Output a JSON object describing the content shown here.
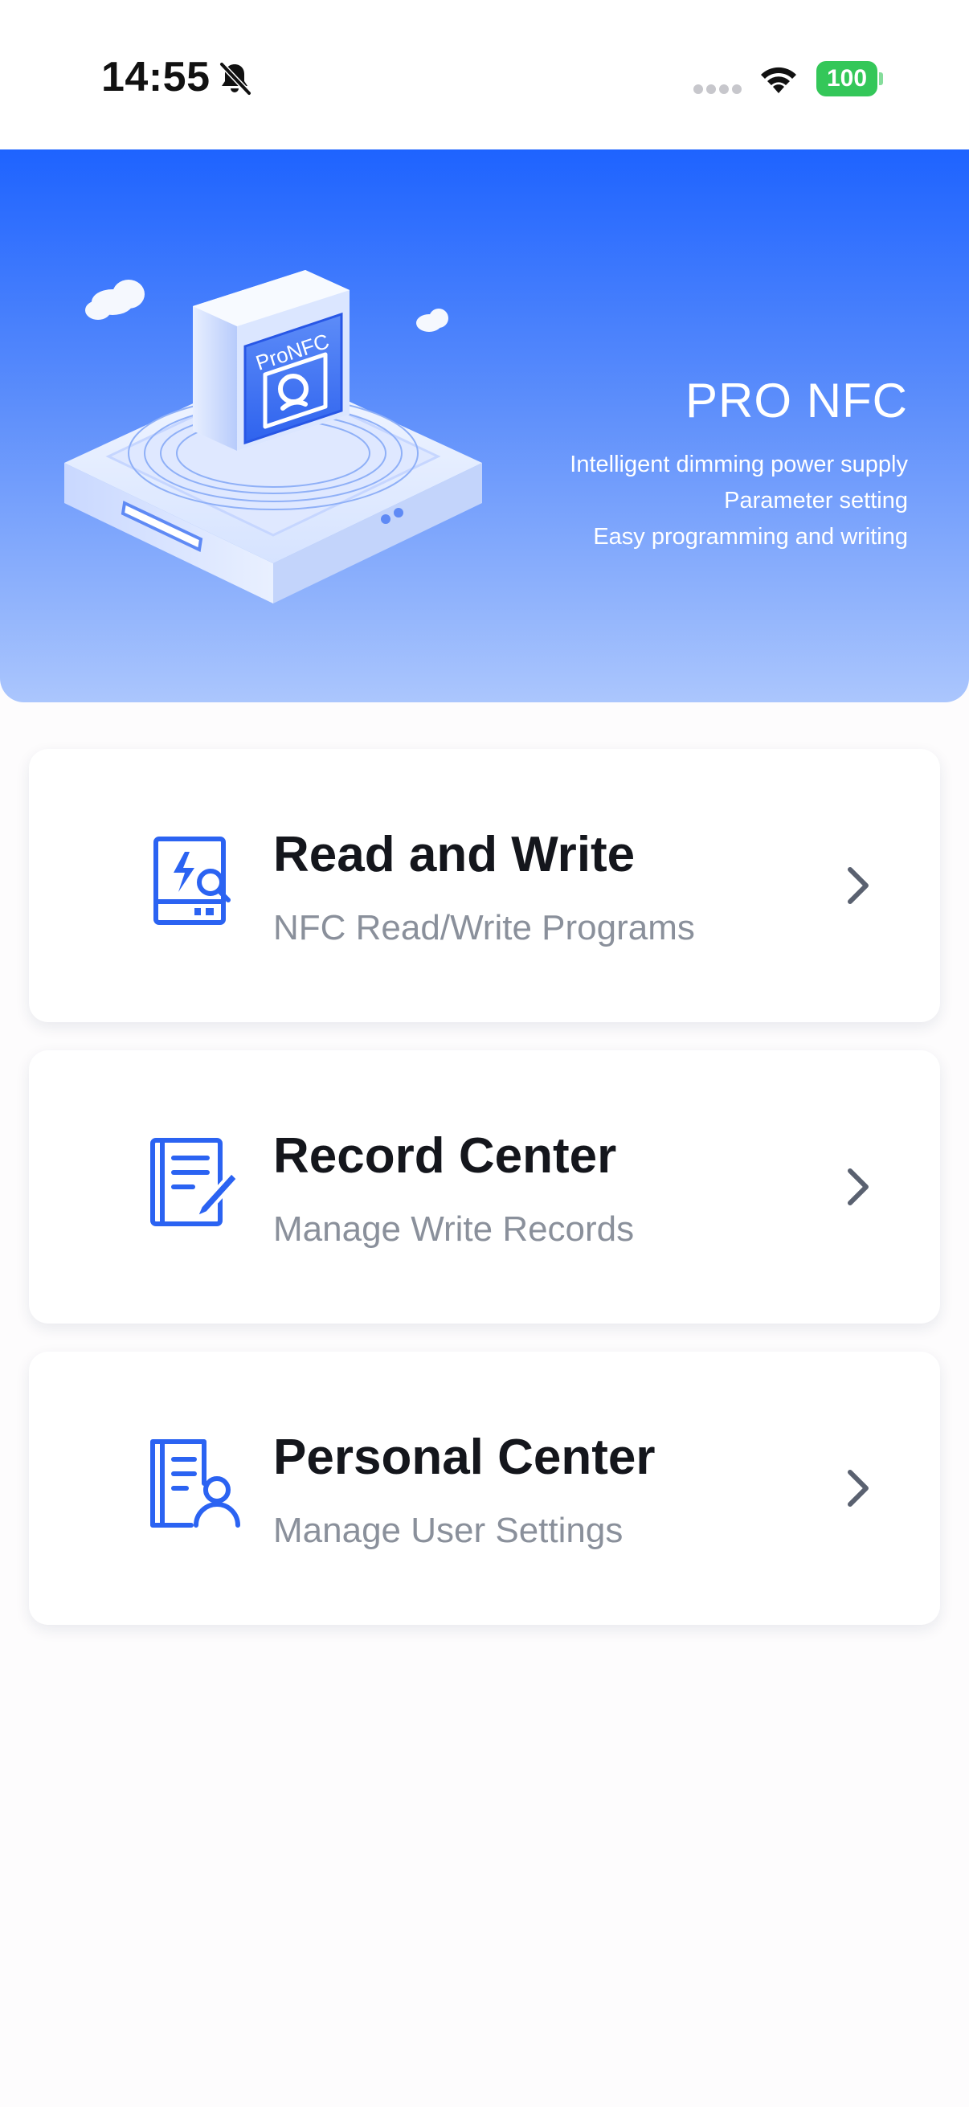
{
  "status_bar": {
    "time": "14:55",
    "battery": "100",
    "icons": [
      "bell-slash-icon",
      "signal-icon",
      "wifi-icon",
      "battery-icon"
    ]
  },
  "hero": {
    "device_label": "ProNFC",
    "title": "PRO NFC",
    "lines": [
      "Intelligent dimming power supply",
      "Parameter setting",
      "Easy programming and writing"
    ]
  },
  "menu": [
    {
      "title": "Read and Write",
      "subtitle": "NFC Read/Write Programs",
      "icon": "nfc-read-write-icon"
    },
    {
      "title": "Record Center",
      "subtitle": "Manage Write Records",
      "icon": "record-edit-icon"
    },
    {
      "title": "Personal Center",
      "subtitle": "Manage User Settings",
      "icon": "user-document-icon"
    }
  ],
  "colors": {
    "accent": "#1e63ff",
    "icon_blue": "#2b63f2",
    "title_text": "#14161c",
    "subtitle_text": "#8a909b",
    "chevron": "#5a6170",
    "battery_green": "#34c759"
  }
}
